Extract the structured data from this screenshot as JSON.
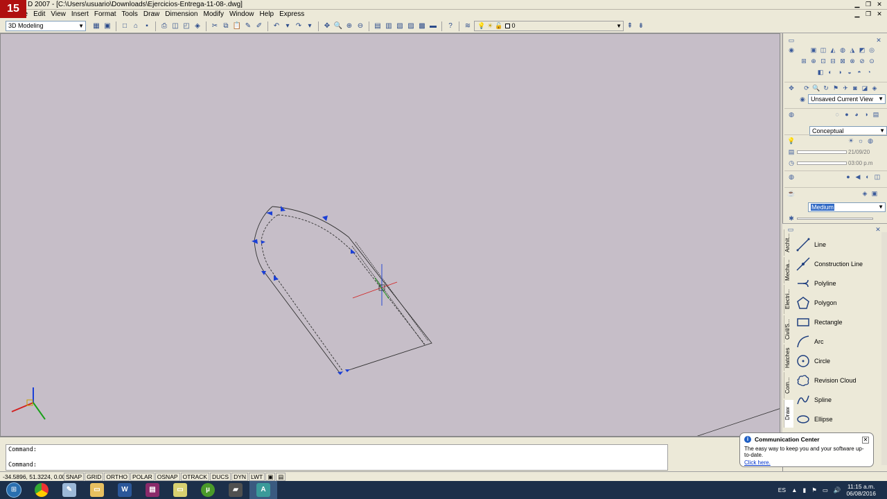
{
  "title": {
    "logo_text": "15",
    "text": "D 2007 - [C:\\Users\\usuario\\Downloads\\Ejercicios-Entrega-11-08-.dwg]"
  },
  "menu": [
    "File",
    "Edit",
    "View",
    "Insert",
    "Format",
    "Tools",
    "Draw",
    "Dimension",
    "Modify",
    "Window",
    "Help",
    "Express"
  ],
  "toolbar": {
    "workspace": "3D Modeling",
    "layer": "0"
  },
  "dashboard": {
    "view": "Unsaved Current View",
    "visual_style": "Conceptual",
    "date": "21/09/20",
    "time": "03:00 p.m",
    "quality": "Medium"
  },
  "tool_palette": {
    "tabs": [
      "Archit...",
      "Mecha...",
      "Electri...",
      "Civil/S...",
      "Hatches",
      "Com...",
      "Draw"
    ],
    "items": [
      {
        "label": "Line",
        "icon": "line-icon"
      },
      {
        "label": "Construction Line",
        "icon": "construction-line-icon"
      },
      {
        "label": "Polyline",
        "icon": "polyline-icon"
      },
      {
        "label": "Polygon",
        "icon": "polygon-icon"
      },
      {
        "label": "Rectangle",
        "icon": "rectangle-icon"
      },
      {
        "label": "Arc",
        "icon": "arc-icon"
      },
      {
        "label": "Circle",
        "icon": "circle-icon"
      },
      {
        "label": "Revision Cloud",
        "icon": "revision-cloud-icon"
      },
      {
        "label": "Spline",
        "icon": "spline-icon"
      },
      {
        "label": "Ellipse",
        "icon": "ellipse-icon"
      }
    ]
  },
  "command": {
    "line1": "Command:",
    "line2": "Command:"
  },
  "status": {
    "coords": "-34.5896, 51.3224, 0.0000",
    "toggles": [
      "SNAP",
      "GRID",
      "ORTHO",
      "POLAR",
      "OSNAP",
      "OTRACK",
      "DUCS",
      "DYN",
      "LWT"
    ]
  },
  "notification": {
    "title": "Communication Center",
    "message": "The easy way to keep you and your software up-to-date.",
    "link": "Click here."
  },
  "taskbar": {
    "lang": "ES",
    "time": "11:15 a.m.",
    "date": "06/08/2016"
  },
  "colors": {
    "viewport_bg": "#c6bec8",
    "grip_blue": "#1a3fd6",
    "axis_red": "#d22020",
    "axis_green": "#1aa01a",
    "axis_blue": "#1a3fd6"
  }
}
